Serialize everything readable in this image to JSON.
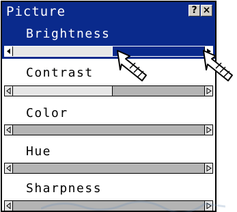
{
  "window": {
    "title": "Picture",
    "help_label": "?",
    "close_label": "×"
  },
  "settings": [
    {
      "label": "Brightness",
      "level": 0.52,
      "selected": true
    },
    {
      "label": "Contrast",
      "level": 0.52,
      "selected": false
    },
    {
      "label": "Color",
      "level": 0.0,
      "selected": false
    },
    {
      "label": "Hue",
      "level": 0.0,
      "selected": false
    },
    {
      "label": "Sharpness",
      "level": 0.0,
      "selected": false
    }
  ],
  "icons": {
    "left_arrow": "arrow-left-icon",
    "right_arrow": "arrow-right-icon",
    "pointer": "hand-pointer-icon",
    "help": "question-icon",
    "close": "close-icon"
  },
  "colors": {
    "title_bar": "#0a2a8c",
    "selection": "#0a2a8c",
    "slider_track": "#b4b4b4",
    "slider_fill": "#e6e6e6"
  }
}
